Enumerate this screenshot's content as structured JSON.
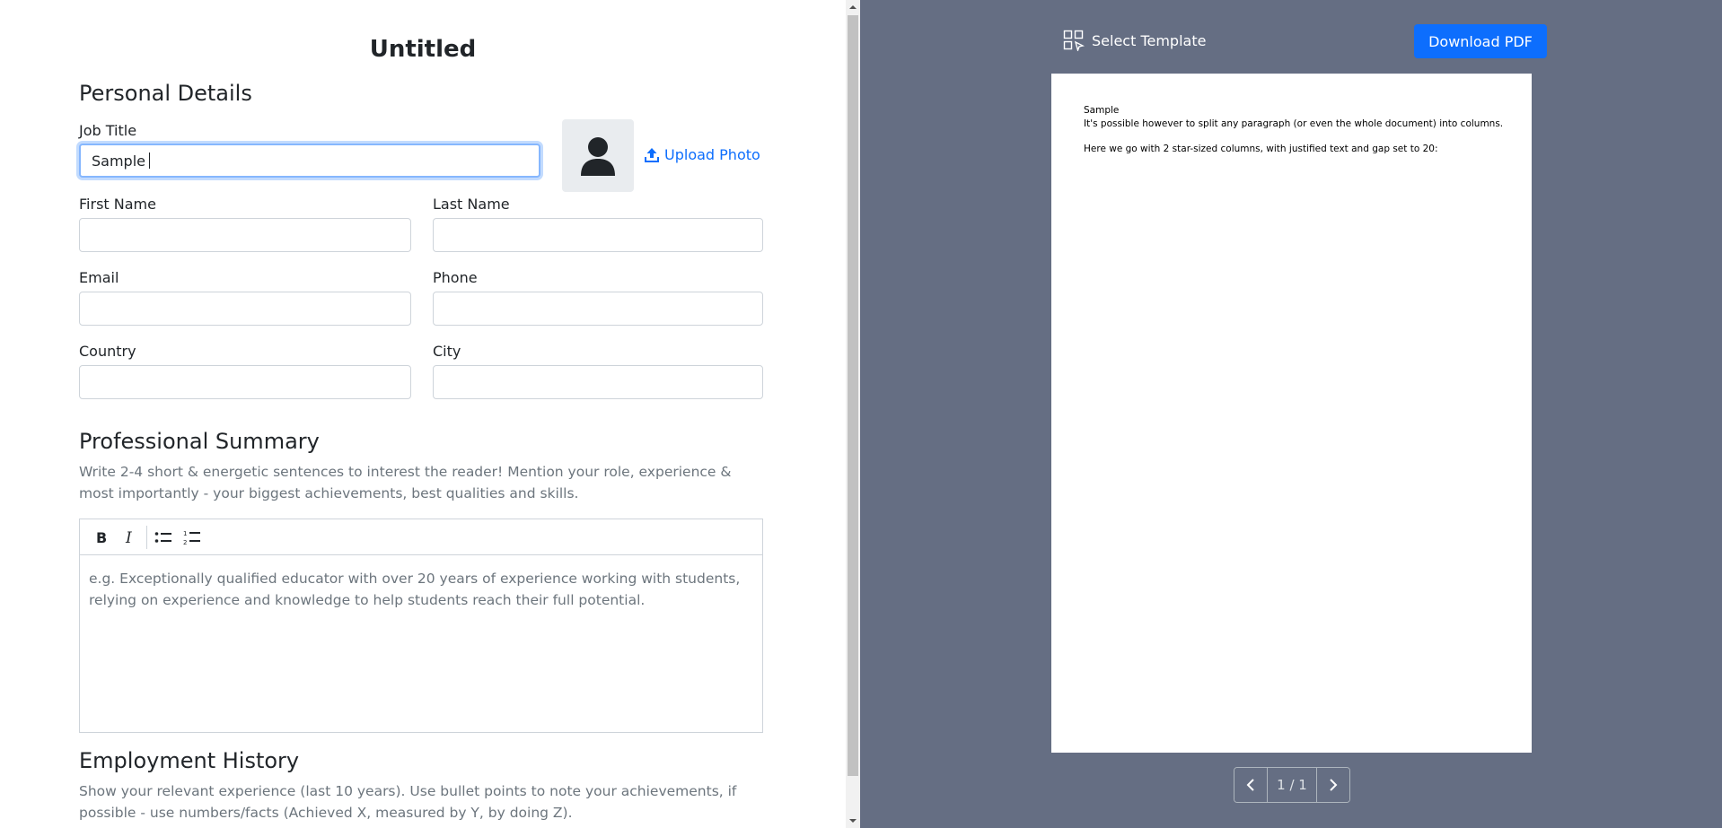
{
  "form": {
    "title": "Untitled",
    "personal": {
      "heading": "Personal Details",
      "job_title_label": "Job Title",
      "job_title_value": "Sample",
      "upload_photo": "Upload Photo",
      "first_name_label": "First Name",
      "last_name_label": "Last Name",
      "email_label": "Email",
      "phone_label": "Phone",
      "country_label": "Country",
      "city_label": "City"
    },
    "summary": {
      "heading": "Professional Summary",
      "help": "Write 2-4 short & energetic sentences to interest the reader! Mention your role, experience & most importantly - your biggest achievements, best qualities and skills.",
      "placeholder": "e.g. Exceptionally qualified educator with over 20 years of experience working with students, relying on experience and knowledge to help students reach their full potential."
    },
    "employment": {
      "heading": "Employment History",
      "help": "Show your relevant experience (last 10 years). Use bullet points to note your achievements, if possible - use numbers/facts (Achieved X, measured by Y, by doing Z)."
    }
  },
  "preview": {
    "select_template": "Select Template",
    "download_pdf": "Download PDF",
    "page_lines": [
      "Sample",
      "It's possible however to split any paragraph (or even the whole document) into columns.",
      "Here we go with 2 star-sized columns, with justified text and gap set to 20:"
    ],
    "page_indicator": "1 / 1"
  },
  "colors": {
    "accent": "#0d6efd",
    "preview_bg": "#656e83",
    "muted_text": "#6c757d"
  }
}
